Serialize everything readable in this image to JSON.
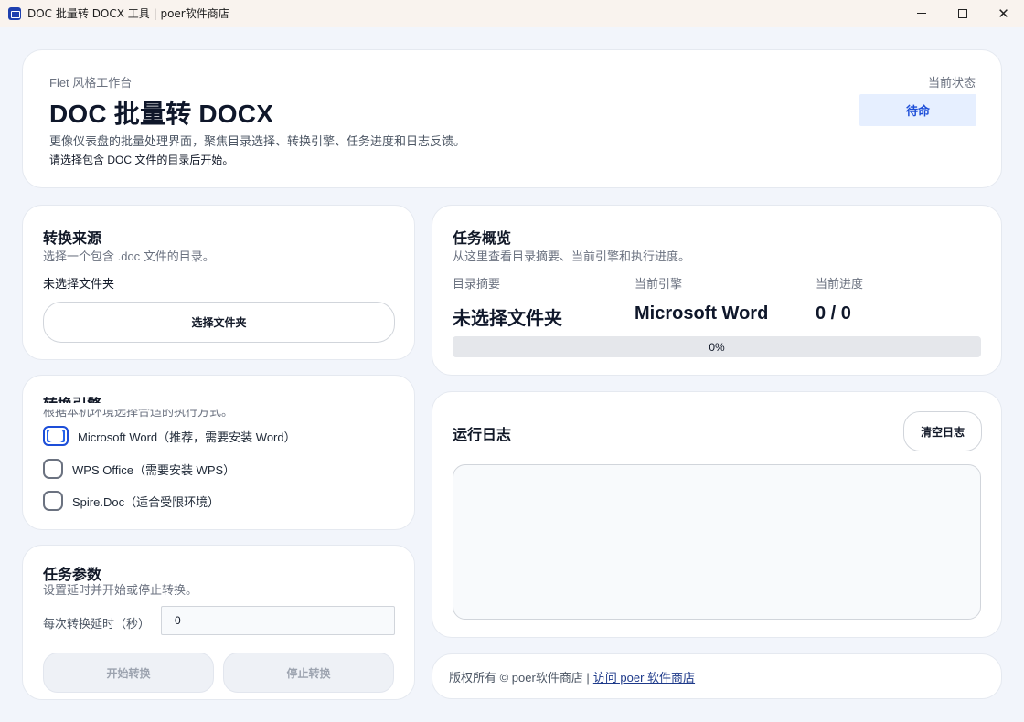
{
  "window": {
    "title": "DOC 批量转 DOCX 工具 | poer软件商店",
    "icon": "app-icon",
    "controls": [
      "minimize-icon",
      "maximize-icon",
      "close-icon"
    ],
    "close_glyph": "✕"
  },
  "header": {
    "kicker": "Flet 风格工作台",
    "title": "DOC 批量转 DOCX",
    "description": "更像仪表盘的批量处理界面，聚焦目录选择、转换引擎、任务进度和日志反馈。",
    "hint": "请选择包含 DOC 文件的目录后开始。",
    "status_label": "当前状态",
    "status_value": "待命"
  },
  "source": {
    "title": "转换来源",
    "subtitle": "选择一个包含 .doc 文件的目录。",
    "folder": "未选择文件夹",
    "pick_button": "选择文件夹"
  },
  "engine": {
    "title": "转换引擎",
    "subtitle": "根据本机环境选择合适的执行方式。",
    "options": [
      {
        "label": "Microsoft Word（推荐，需要安装 Word）",
        "selected": true
      },
      {
        "label": "WPS Office（需要安装 WPS）",
        "selected": false
      },
      {
        "label": "Spire.Doc（适合受限环境）",
        "selected": false
      }
    ]
  },
  "params": {
    "title": "任务参数",
    "subtitle": "设置延时并开始或停止转换。",
    "delay_label": "每次转换延时（秒）",
    "delay_value": "0",
    "start_button": "开始转换",
    "stop_button": "停止转换"
  },
  "overview": {
    "title": "任务概览",
    "subtitle": "从这里查看目录摘要、当前引擎和执行进度。",
    "dir_label": "目录摘要",
    "dir_value": "未选择文件夹",
    "engine_label": "当前引擎",
    "engine_value": "Microsoft Word",
    "progress_label": "当前进度",
    "progress_value": "0 / 0",
    "progress_percent": 0,
    "progress_text": "0%"
  },
  "log": {
    "title": "运行日志",
    "clear_button": "清空日志",
    "entries": []
  },
  "footer": {
    "copyright": "版权所有 © poer软件商店 |",
    "link_text": "访问 poer 软件商店"
  },
  "colors": {
    "accent": "#2563eb",
    "status_badge_bg": "#e6efff",
    "background": "#f2f5fb"
  }
}
